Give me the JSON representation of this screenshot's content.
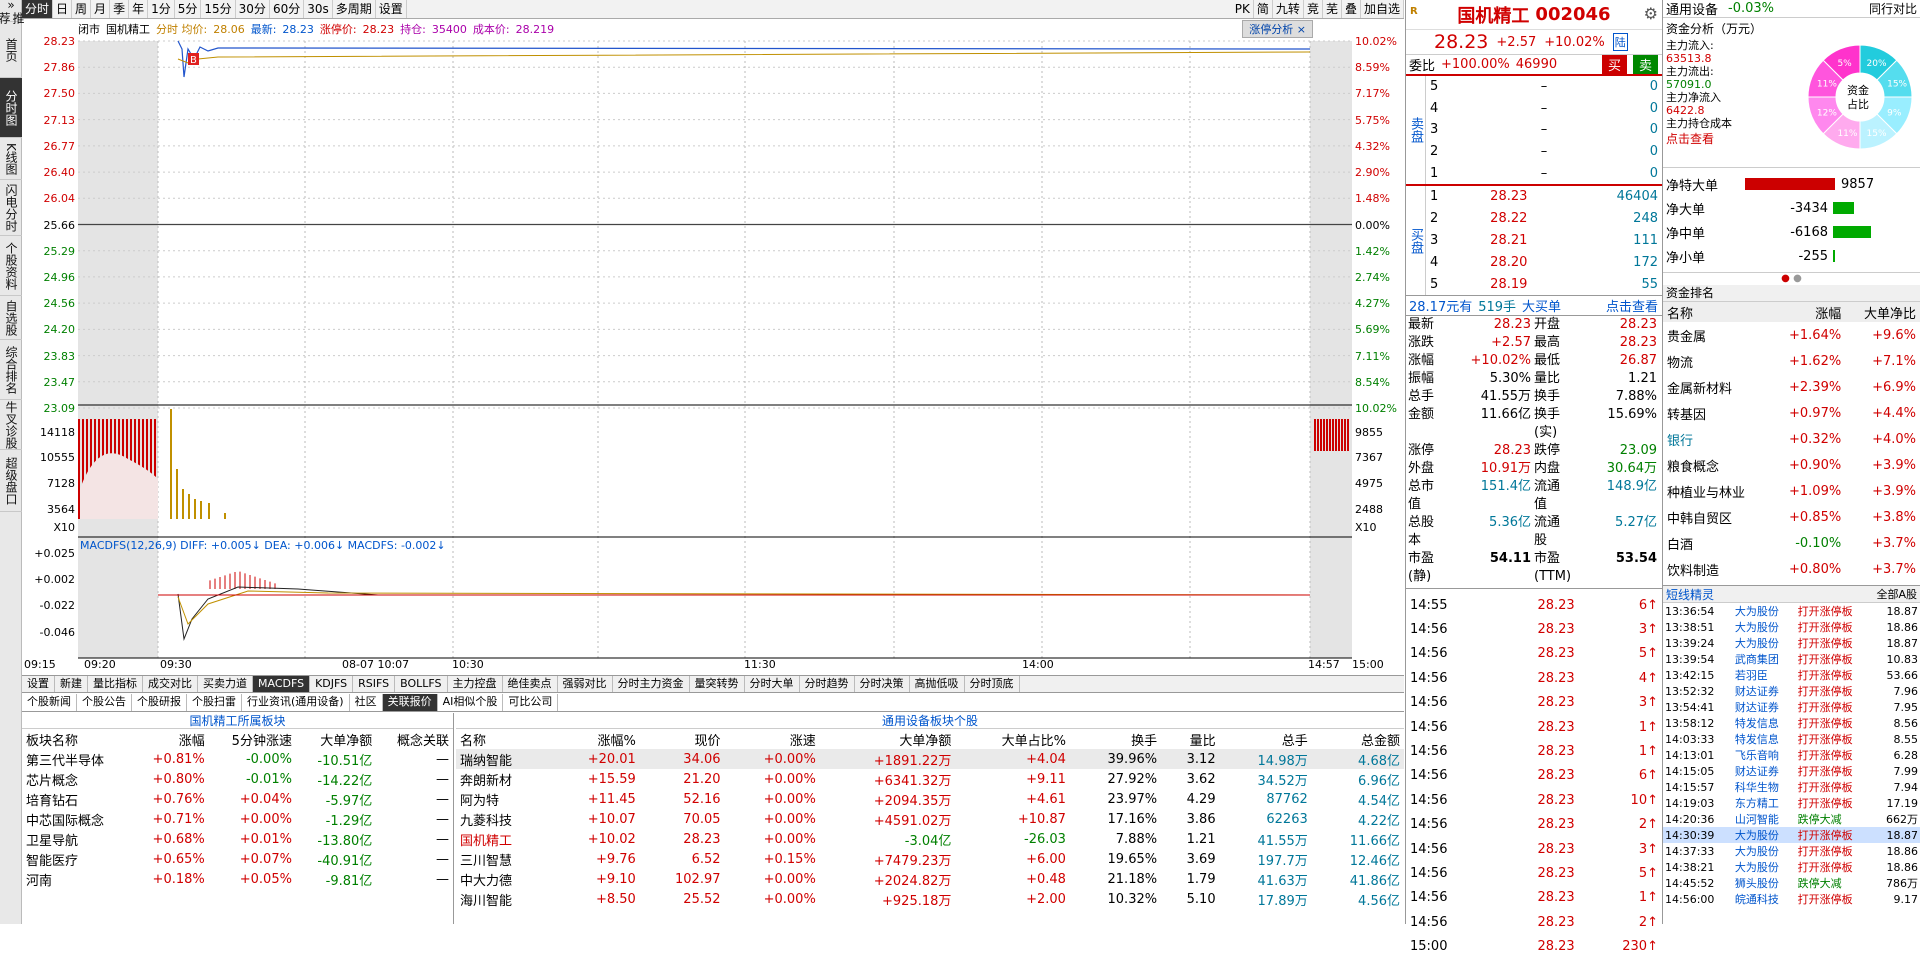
{
  "leftnav": [
    {
      "label": "推荐",
      "icon": "»"
    },
    {
      "label": "首页"
    },
    {
      "label": "分时图",
      "active": true
    },
    {
      "label": "K线图"
    },
    {
      "label": "闪电分时"
    },
    {
      "label": "个股资料"
    },
    {
      "label": "自选股"
    },
    {
      "label": "综合排名"
    },
    {
      "label": "牛叉诊股"
    },
    {
      "label": "超级盘口"
    }
  ],
  "topbar": {
    "periods": [
      "分时",
      "日",
      "周",
      "月",
      "季",
      "年",
      "1分",
      "5分",
      "15分",
      "30分",
      "60分",
      "30s",
      "多周期",
      "设置"
    ],
    "right": [
      "PK",
      "简",
      "九转",
      "竞",
      "芜",
      "叠",
      "加自选"
    ]
  },
  "chartinfo": {
    "status": "闭市",
    "name": "国机精工",
    "avg_label": "分时 均价:",
    "avg": "28.06",
    "last_label": "最新:",
    "last": "28.23",
    "limit_label": "涨停价:",
    "limit": "28.23",
    "pos_label": "持仓:",
    "pos": "35400",
    "cost_label": "成本价:",
    "cost": "28.219",
    "zt_btn": "涨停分析",
    "close": "×"
  },
  "axes": {
    "left_price": [
      "28.23",
      "27.86",
      "27.50",
      "27.13",
      "26.77",
      "26.40",
      "26.04",
      "25.66",
      "25.29",
      "24.96",
      "24.56",
      "24.20",
      "23.83",
      "23.47",
      "23.09"
    ],
    "right_pct": [
      "10.02%",
      "8.59%",
      "7.17%",
      "5.75%",
      "4.32%",
      "2.90%",
      "1.48%",
      "0.00%",
      "1.42%",
      "2.74%",
      "4.27%",
      "5.69%",
      "7.11%",
      "8.54%",
      "10.02%"
    ],
    "left_vol": [
      "14118",
      "10555",
      "7128",
      "3564",
      "X10"
    ],
    "right_vol": [
      "9855",
      "7367",
      "4975",
      "2488",
      "X10"
    ],
    "left_macd": [
      "+0.025",
      "+0.002",
      "-0.022",
      "-0.046"
    ],
    "macd_label": "MACDFS(12,26,9) DIFF: +0.005↓ DEA: +0.006↓ MACDFS: -0.002↓",
    "buy_marker": "B"
  },
  "timeaxis": [
    "09:15",
    "09:20",
    "09:30",
    "08-07 10:07",
    "10:30",
    "11:30",
    "14:00",
    "14:57",
    "15:00"
  ],
  "subtabs": [
    "设置",
    "新建",
    "量比指标",
    "成交对比",
    "买卖力道",
    "MACDFS",
    "KDJFS",
    "RSIFS",
    "BOLLFS",
    "主力控盘",
    "绝佳卖点",
    "强弱对比",
    "分时主力资金",
    "量突转势",
    "分时大单",
    "分时趋势",
    "分时决策",
    "高抛低吸",
    "分时顶底"
  ],
  "newstabs": [
    "个股新闻",
    "个股公告",
    "个股研报",
    "个股扫雷",
    "行业资讯(通用设备)",
    "社区",
    "关联报价",
    "AI相似个股",
    "可比公司"
  ],
  "board": {
    "title": "国机精工所属板块",
    "headers": [
      "板块名称",
      "涨幅",
      "5分钟涨速",
      "大单净额",
      "概念关联"
    ],
    "rows": [
      [
        "第三代半导体",
        "+0.81%",
        "-0.00%",
        "-10.51亿",
        "—"
      ],
      [
        "芯片概念",
        "+0.80%",
        "-0.01%",
        "-14.22亿",
        "—"
      ],
      [
        "培育钻石",
        "+0.76%",
        "+0.04%",
        "-5.97亿",
        "—"
      ],
      [
        "中芯国际概念",
        "+0.71%",
        "+0.00%",
        "-1.29亿",
        "—"
      ],
      [
        "卫星导航",
        "+0.68%",
        "+0.01%",
        "-13.80亿",
        "—"
      ],
      [
        "智能医疗",
        "+0.65%",
        "+0.07%",
        "-40.91亿",
        "—"
      ],
      [
        "河南",
        "+0.18%",
        "+0.05%",
        "-9.81亿",
        "—"
      ]
    ]
  },
  "stocks": {
    "title": "通用设备板块个股",
    "headers": [
      "名称",
      "涨幅%",
      "现价",
      "涨速",
      "大单净额",
      "大单占比%",
      "换手",
      "量比",
      "总手",
      "总金额"
    ],
    "rows": [
      [
        "瑞纳智能",
        "+20.01",
        "34.06",
        "+0.00%",
        "+1891.22万",
        "+4.04",
        "39.96%",
        "3.12",
        "14.98万",
        "4.68亿"
      ],
      [
        "奔朗新材",
        "+15.59",
        "21.20",
        "+0.00%",
        "+6341.32万",
        "+9.11",
        "27.92%",
        "3.62",
        "34.52万",
        "6.96亿"
      ],
      [
        "阿为特",
        "+11.45",
        "52.16",
        "+0.00%",
        "+2094.35万",
        "+4.61",
        "23.97%",
        "4.29",
        "87762",
        "4.54亿"
      ],
      [
        "九菱科技",
        "+10.07",
        "70.05",
        "+0.00%",
        "+4591.02万",
        "+10.87",
        "17.16%",
        "3.86",
        "62263",
        "4.22亿"
      ],
      [
        "国机精工",
        "+10.02",
        "28.23",
        "+0.00%",
        "-3.04亿",
        "-26.03",
        "7.88%",
        "1.21",
        "41.55万",
        "11.66亿"
      ],
      [
        "三川智慧",
        "+9.76",
        "6.52",
        "+0.15%",
        "+7479.23万",
        "+6.00",
        "19.65%",
        "3.69",
        "197.7万",
        "12.46亿"
      ],
      [
        "中大力德",
        "+9.10",
        "102.97",
        "+0.00%",
        "+2024.82万",
        "+0.48",
        "21.18%",
        "1.79",
        "41.63万",
        "41.86亿"
      ],
      [
        "海川智能",
        "+8.50",
        "25.52",
        "+0.00%",
        "+925.18万",
        "+2.00",
        "10.32%",
        "5.10",
        "17.89万",
        "4.56亿"
      ]
    ]
  },
  "quote": {
    "name": "国机精工",
    "code": "002046",
    "price": "28.23",
    "chg": "+2.57",
    "pct": "+10.02%",
    "tag": "陆",
    "wb_label": "委比",
    "wb": "+100.00%",
    "wc": "46990",
    "buy": "买",
    "sell": "卖"
  },
  "orderbook": {
    "sell_label": "卖盘",
    "buy_label": "买盘",
    "sell": [
      [
        "5",
        "–",
        "0"
      ],
      [
        "4",
        "–",
        "0"
      ],
      [
        "3",
        "–",
        "0"
      ],
      [
        "2",
        "–",
        "0"
      ],
      [
        "1",
        "–",
        "0"
      ]
    ],
    "buy": [
      [
        "1",
        "28.23",
        "46404"
      ],
      [
        "2",
        "28.22",
        "248"
      ],
      [
        "3",
        "28.21",
        "111"
      ],
      [
        "4",
        "28.20",
        "172"
      ],
      [
        "5",
        "28.19",
        "55"
      ]
    ]
  },
  "bigbuy": {
    "price": "28.17元有",
    "qty": "519手",
    "label": "大买单",
    "link": "点击查看"
  },
  "stats": [
    [
      "最新",
      "28.23",
      "开盘",
      "28.23"
    ],
    [
      "涨跌",
      "+2.57",
      "最高",
      "28.23"
    ],
    [
      "涨幅",
      "+10.02%",
      "最低",
      "26.87"
    ],
    [
      "振幅",
      "5.30%",
      "量比",
      "1.21"
    ],
    [
      "总手",
      "41.55万",
      "换手",
      "7.88%"
    ],
    [
      "金额",
      "11.66亿",
      "换手(实)",
      "15.69%"
    ],
    [
      "涨停",
      "28.23",
      "跌停",
      "23.09"
    ],
    [
      "外盘",
      "10.91万",
      "内盘",
      "30.64万"
    ],
    [
      "总市值",
      "151.4亿",
      "流通值",
      "148.9亿"
    ],
    [
      "总股本",
      "5.36亿",
      "流通股",
      "5.27亿"
    ],
    [
      "市盈(静)",
      "54.11",
      "市盈(TTM)",
      "53.54"
    ]
  ],
  "ticks": [
    [
      "14:55",
      "28.23",
      "6"
    ],
    [
      "14:56",
      "28.23",
      "3"
    ],
    [
      "14:56",
      "28.23",
      "5"
    ],
    [
      "14:56",
      "28.23",
      "4"
    ],
    [
      "14:56",
      "28.23",
      "3"
    ],
    [
      "14:56",
      "28.23",
      "1"
    ],
    [
      "14:56",
      "28.23",
      "1"
    ],
    [
      "14:56",
      "28.23",
      "6"
    ],
    [
      "14:56",
      "28.23",
      "10"
    ],
    [
      "14:56",
      "28.23",
      "2"
    ],
    [
      "14:56",
      "28.23",
      "3"
    ],
    [
      "14:56",
      "28.23",
      "5"
    ],
    [
      "14:56",
      "28.23",
      "1"
    ],
    [
      "14:56",
      "28.23",
      "2"
    ],
    [
      "15:00",
      "28.23",
      "230"
    ]
  ],
  "fund": {
    "sector": "通用设备",
    "sector_pct": "-0.03%",
    "compare": "同行对比",
    "title": "资金分析（万元）",
    "items": [
      [
        "主力流入:",
        "63513.8"
      ],
      [
        "主力流出:",
        "57091.0"
      ],
      [
        "主力净流入",
        "6422.8"
      ],
      [
        "主力持仓成本",
        ""
      ]
    ],
    "link": "点击查看",
    "pie_label": "资金占比",
    "pie_pct": [
      "20%",
      "15%",
      "9%",
      "15%",
      "11%",
      "12%",
      "11%",
      "5%"
    ]
  },
  "netflow": [
    [
      "净特大单",
      "9857",
      1.0
    ],
    [
      "净大单",
      "-3434",
      0.35
    ],
    [
      "净中单",
      "-6168",
      0.63
    ],
    [
      "净小单",
      "-255",
      0.03
    ]
  ],
  "rank": {
    "title": "资金排名",
    "headers": [
      "名称",
      "涨幅",
      "大单净比"
    ],
    "rows": [
      [
        "贵金属",
        "+1.64%",
        "+9.6%"
      ],
      [
        "物流",
        "+1.62%",
        "+7.1%"
      ],
      [
        "金属新材料",
        "+2.39%",
        "+6.9%"
      ],
      [
        "转基因",
        "+0.97%",
        "+4.4%"
      ],
      [
        "银行",
        "+0.32%",
        "+4.0%"
      ],
      [
        "粮食概念",
        "+0.90%",
        "+3.9%"
      ],
      [
        "种植业与林业",
        "+1.09%",
        "+3.9%"
      ],
      [
        "中韩自贸区",
        "+0.85%",
        "+3.8%"
      ],
      [
        "白酒",
        "-0.10%",
        "+3.7%"
      ],
      [
        "饮料制造",
        "+0.80%",
        "+3.7%"
      ]
    ]
  },
  "sprite": {
    "title": "短线精灵",
    "filter": "全部A股",
    "rows": [
      [
        "13:36:54",
        "大为股份",
        "打开涨停板",
        "18.87"
      ],
      [
        "13:38:51",
        "大为股份",
        "打开涨停板",
        "18.86"
      ],
      [
        "13:39:24",
        "大为股份",
        "打开涨停板",
        "18.87"
      ],
      [
        "13:39:54",
        "武商集团",
        "打开涨停板",
        "10.83"
      ],
      [
        "13:42:15",
        "若羽臣",
        "打开涨停板",
        "53.66"
      ],
      [
        "13:52:32",
        "财达证券",
        "打开涨停板",
        "7.96"
      ],
      [
        "13:54:41",
        "财达证券",
        "打开涨停板",
        "7.95"
      ],
      [
        "13:58:12",
        "特发信息",
        "打开涨停板",
        "8.56"
      ],
      [
        "14:03:33",
        "特发信息",
        "打开涨停板",
        "8.55"
      ],
      [
        "14:13:01",
        "飞乐音响",
        "打开涨停板",
        "6.28"
      ],
      [
        "14:15:05",
        "财达证券",
        "打开涨停板",
        "7.99"
      ],
      [
        "14:15:57",
        "科华生物",
        "打开涨停板",
        "7.94"
      ],
      [
        "14:19:03",
        "东方精工",
        "打开涨停板",
        "17.19"
      ],
      [
        "14:20:36",
        "山河智能",
        "跌停大减",
        "662万"
      ],
      [
        "14:30:39",
        "大为股份",
        "打开涨停板",
        "18.87"
      ],
      [
        "14:37:33",
        "大为股份",
        "打开涨停板",
        "18.86"
      ],
      [
        "14:38:21",
        "大为股份",
        "打开涨停板",
        "18.86"
      ],
      [
        "14:45:52",
        "狮头股份",
        "跌停大减",
        "786万"
      ],
      [
        "14:56:00",
        "皖通科技",
        "打开涨停板",
        "9.17"
      ]
    ]
  },
  "colors": {
    "up": "#d00000",
    "down": "#008000",
    "blue": "#0055cc",
    "dark": "#333333"
  }
}
